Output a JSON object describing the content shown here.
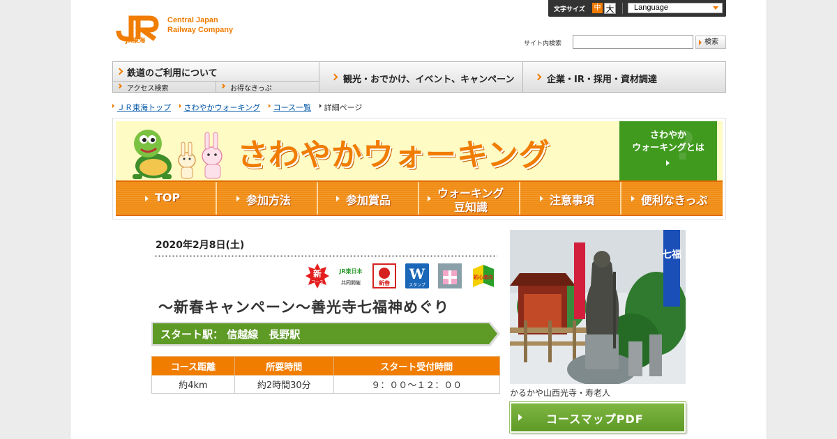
{
  "header": {
    "logo_mark": "JR",
    "logo_sub": "JR東海",
    "company_line1": "Central Japan",
    "company_line2": "Railway Company",
    "font_size_label": "文字サイズ",
    "font_size_medium": "中",
    "font_size_large": "大",
    "language_label": "Language",
    "search_label": "サイト内検索",
    "search_value": "",
    "search_button": "検索"
  },
  "global_nav": {
    "item1": "鉄道のご利用について",
    "item1_sub1": "アクセス検索",
    "item1_sub2": "お得なきっぷ",
    "item2": "観光・おでかけ、イベント、キャンペーン",
    "item3": "企業・IR・採用・資材調達"
  },
  "breadcrumb": {
    "items": [
      "ＪＲ東海トップ",
      "さわやかウォーキング",
      "コース一覧"
    ],
    "current": "詳細ページ"
  },
  "banner": {
    "title": "さわやかウォーキング",
    "about_line1": "さわやか",
    "about_line2": "ウォーキングとは",
    "nav": [
      "TOP",
      "参加方法",
      "参加賞品",
      "ウォーキング",
      "豆知識",
      "注意事項",
      "便利なきっぷ"
    ]
  },
  "event": {
    "date": "2020年2月8日(土)",
    "badges": {
      "new_top": "新",
      "new_bottom": "コース",
      "joint_top": "JR東日本",
      "joint_bottom": "共同開催",
      "shinshun": "新春",
      "w_letter": "W",
      "w_bottom": "スタンプ",
      "beginner": "初心者向"
    },
    "title": "～新春キャンペーン～善光寺七福神めぐり",
    "start_label": "スタート駅：",
    "start_line": "信越線",
    "start_station": "長野駅",
    "table_headers": [
      "コース距離",
      "所要時間",
      "スタート受付時間"
    ],
    "table_values": [
      "約4km",
      "約2時間30分",
      "９：００～１２：００"
    ]
  },
  "photo": {
    "caption": "かるかや山西光寺・寿老人",
    "banner_text": "七福"
  },
  "pdf_button": "コースマップPDF",
  "colors": {
    "accent": "#f07c00",
    "green": "#5e9a26",
    "banner_bg": "#fffbc5",
    "link": "#0055a6"
  }
}
